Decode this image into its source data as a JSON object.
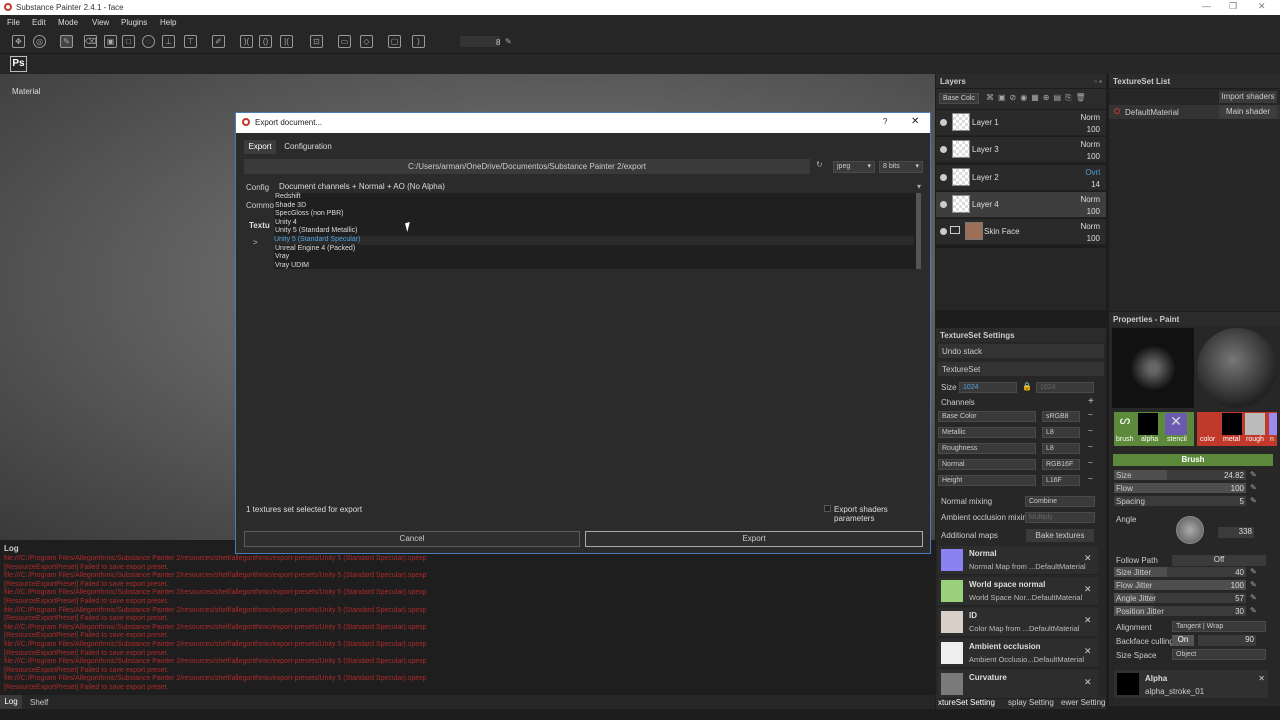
{
  "app": {
    "title": "Substance Painter 2.4.1 - face",
    "min": "—",
    "max": "❐",
    "close": "✕"
  },
  "menu": [
    "File",
    "Edit",
    "Mode",
    "View",
    "Plugins",
    "Help"
  ],
  "toolbar": {
    "ps_label": "Ps",
    "size_value": "8"
  },
  "viewport": {
    "label": "Material"
  },
  "layers": {
    "title": "Layers",
    "blend_channel": "Base Colc",
    "items": [
      {
        "name": "Layer 1",
        "blend": "Norm",
        "opacity": "100",
        "selected": false
      },
      {
        "name": "Layer 3",
        "blend": "Norm",
        "opacity": "100",
        "selected": false
      },
      {
        "name": "Layer 2",
        "blend": "Ovrl",
        "opacity": "14",
        "selected": false
      },
      {
        "name": "Layer 4",
        "blend": "Norm",
        "opacity": "100",
        "selected": true
      },
      {
        "name": "Skin Face",
        "blend": "Norm",
        "opacity": "100",
        "selected": false
      }
    ]
  },
  "textureset_list": {
    "title": "TextureSet List",
    "import_button": "Import shaders",
    "item": "DefaultMaterial",
    "shader": "Main shader"
  },
  "textureset_settings": {
    "title": "TextureSet Settings",
    "undo_stack": "Undo stack",
    "textureset": "TextureSet",
    "size_label": "Size",
    "size_value": "1024",
    "size_value2": "1024",
    "channels_label": "Channels",
    "channels": [
      {
        "name": "Base Color",
        "format": "sRGB8"
      },
      {
        "name": "Metallic",
        "format": "L8"
      },
      {
        "name": "Roughness",
        "format": "L8"
      },
      {
        "name": "Normal",
        "format": "RGB16F"
      },
      {
        "name": "Height",
        "format": "L16F"
      }
    ],
    "normal_mixing_label": "Normal mixing",
    "normal_mixing_value": "Combine",
    "ao_mixing_label": "Ambient occlusion mixing",
    "ao_mixing_value": "Multiply",
    "additional_maps": "Additional maps",
    "bake_button": "Bake textures",
    "maps": [
      {
        "name": "Normal",
        "desc": "Normal Map from ...DefaultMaterial",
        "color": "#8a82f0"
      },
      {
        "name": "World space normal",
        "desc": "World Space Nor...DefaultMaterial",
        "color": "#9bd07a"
      },
      {
        "name": "ID",
        "desc": "Color Map from ...DefaultMaterial",
        "color": "#d8d0c6"
      },
      {
        "name": "Ambient occlusion",
        "desc": "Ambient Occlusio...DefaultMaterial",
        "color": "#eeeeee"
      },
      {
        "name": "Curvature",
        "desc": "",
        "color": "#7a7a7a"
      }
    ],
    "bottom_tabs": [
      "xtureSet Setting",
      "splay Setting",
      "ewer Setting"
    ]
  },
  "properties": {
    "title": "Properties - Paint",
    "slots": [
      "brush",
      "alpha",
      "stencil",
      "color",
      "metal",
      "rough",
      "n"
    ],
    "brush_header": "Brush",
    "size_label": "Size",
    "size_value": "24.82",
    "size_fill": 0.4,
    "flow_label": "Flow",
    "flow_value": "100",
    "flow_fill": 1.0,
    "spacing_label": "Spacing",
    "spacing_value": "5",
    "angle_label": "Angle",
    "angle_value": "338",
    "follow_path_label": "Follow Path",
    "follow_path_value": "Off",
    "size_jitter_label": "Size Jitter",
    "size_jitter_value": "40",
    "size_jitter_fill": 0.4,
    "flow_jitter_label": "Flow Jitter",
    "flow_jitter_value": "100",
    "flow_jitter_fill": 1.0,
    "angle_jitter_label": "Angle Jitter",
    "angle_jitter_value": "57",
    "angle_jitter_fill": 0.3,
    "position_jitter_label": "Position Jitter",
    "position_jitter_value": "30",
    "position_jitter_fill": 0.3,
    "alignment_label": "Alignment",
    "alignment_value": "Tangent | Wrap",
    "backface_label": "Backface culling",
    "backface_on": "On",
    "backface_value": "90",
    "size_space_label": "Size Space",
    "size_space_value": "Object",
    "alpha_label": "Alpha",
    "alpha_value": "alpha_stroke_01"
  },
  "log": {
    "title": "Log",
    "lines": [
      "file:///C:/Program Files/Allegorithmic/Substance Painter 2/resources/shelf/allegorithmic/export-presets/Unity 5 (Standard Specular).spexp",
      "[ResourceExportPreset] Failed to save export preset.",
      "file:///C:/Program Files/Allegorithmic/Substance Painter 2/resources/shelf/allegorithmic/export-presets/Unity 5 (Standard Specular).spexp",
      "[ResourceExportPreset] Failed to save export preset.",
      "file:///C:/Program Files/Allegorithmic/Substance Painter 2/resources/shelf/allegorithmic/export-presets/Unity 5 (Standard Specular).spexp",
      "[ResourceExportPreset] Failed to save export preset.",
      "file:///C:/Program Files/Allegorithmic/Substance Painter 2/resources/shelf/allegorithmic/export-presets/Unity 5 (Standard Specular).spexp",
      "[ResourceExportPreset] Failed to save export preset.",
      "file:///C:/Program Files/Allegorithmic/Substance Painter 2/resources/shelf/allegorithmic/export-presets/Unity 5 (Standard Specular).spexp",
      "[ResourceExportPreset] Failed to save export preset.",
      "file:///C:/Program Files/Allegorithmic/Substance Painter 2/resources/shelf/allegorithmic/export-presets/Unity 5 (Standard Specular).spexp",
      "[ResourceExportPreset] Failed to save export preset.",
      "file:///C:/Program Files/Allegorithmic/Substance Painter 2/resources/shelf/allegorithmic/export-presets/Unity 5 (Standard Specular).spexp",
      "[ResourceExportPreset] Failed to save export preset.",
      "file:///C:/Program Files/Allegorithmic/Substance Painter 2/resources/shelf/allegorithmic/export-presets/Unity 5 (Standard Specular).spexp",
      "[ResourceExportPreset] Failed to save export preset."
    ],
    "tabs": [
      "Log",
      "Shelf"
    ]
  },
  "dialog": {
    "title": "Export document...",
    "help": "?",
    "close": "✕",
    "tabs": [
      "Export",
      "Configuration"
    ],
    "path": "C:/Users/arman/OneDrive/Documentos/Substance Painter 2/export",
    "format": "jpeg",
    "bits": "8 bits",
    "config_label": "Config",
    "config_value": "Document channels + Normal + AO (No Alpha)",
    "common_label": "Commo",
    "textures_label": "Textu",
    "options": [
      "Redshift",
      "Shade 3D",
      "SpecGloss (non PBR)",
      "Unity 4",
      "Unity 5 (Standard Metallic)",
      "Unity 5 (Standard Specular)",
      "Unreal Engine 4 (Packed)",
      "Vray",
      "Vray UDIM"
    ],
    "highlighted_option": 5,
    "status": "1 textures set selected for export",
    "export_shaders": "Export shaders parameters",
    "cancel": "Cancel",
    "export": "Export"
  }
}
